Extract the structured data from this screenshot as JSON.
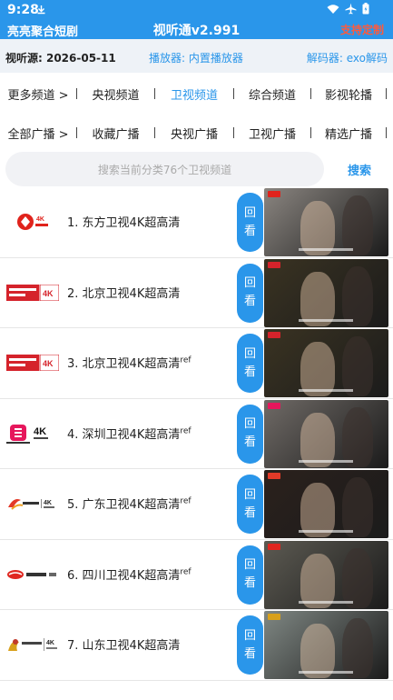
{
  "status": {
    "time": "9:28"
  },
  "header": {
    "left_label": "亮亮聚合短剧",
    "title": "视听通v2.991",
    "right_label": "支持定制"
  },
  "info": {
    "source": "视听源: 2026-05-11",
    "player": "播放器: 内置播放器",
    "decoder": "解码器: exo解码"
  },
  "nav_channels": [
    {
      "label": "更多频道 >",
      "active": false
    },
    {
      "label": "央视频道",
      "active": false
    },
    {
      "label": "卫视频道",
      "active": true
    },
    {
      "label": "综合频道",
      "active": false
    },
    {
      "label": "影视轮播",
      "active": false
    }
  ],
  "nav_radio": [
    {
      "label": "全部广播 >"
    },
    {
      "label": "收藏广播"
    },
    {
      "label": "央视广播"
    },
    {
      "label": "卫视广播"
    },
    {
      "label": "精选广播"
    }
  ],
  "search": {
    "placeholder": "搜索当前分类76个卫视频道",
    "button": "搜索"
  },
  "replay_label_top": "回",
  "replay_label_bottom": "看",
  "channels": [
    {
      "index": "1.",
      "name": "东方卫视4K超高清",
      "suffix": "",
      "logo": "dragon",
      "logo_color": "#e0231c",
      "thumb": "#8a8580"
    },
    {
      "index": "2.",
      "name": "北京卫视4K超高清",
      "suffix": "",
      "logo": "beijing",
      "logo_color": "#d5232b",
      "thumb": "#3a3322"
    },
    {
      "index": "3.",
      "name": "北京卫视4K超高清",
      "suffix": "ref",
      "logo": "beijing",
      "logo_color": "#d5232b",
      "thumb": "#3a3322"
    },
    {
      "index": "4.",
      "name": "深圳卫视4K超高清",
      "suffix": "ref",
      "logo": "shenzhen",
      "logo_color": "#e6175c",
      "thumb": "#6f6a66"
    },
    {
      "index": "5.",
      "name": "广东卫视4K超高清",
      "suffix": "ref",
      "logo": "guangdong",
      "logo_color": "#e33a28",
      "thumb": "#2b211c"
    },
    {
      "index": "6.",
      "name": "四川卫视4K超高清",
      "suffix": "ref",
      "logo": "sichuan",
      "logo_color": "#e0261f",
      "thumb": "#5c5a52"
    },
    {
      "index": "7.",
      "name": "山东卫视4K超高清",
      "suffix": "",
      "logo": "shandong",
      "logo_color": "#d8a01a",
      "thumb": "#7f8783"
    }
  ],
  "colors": {
    "accent": "#2a96ea",
    "warning": "#ff5a3c"
  }
}
